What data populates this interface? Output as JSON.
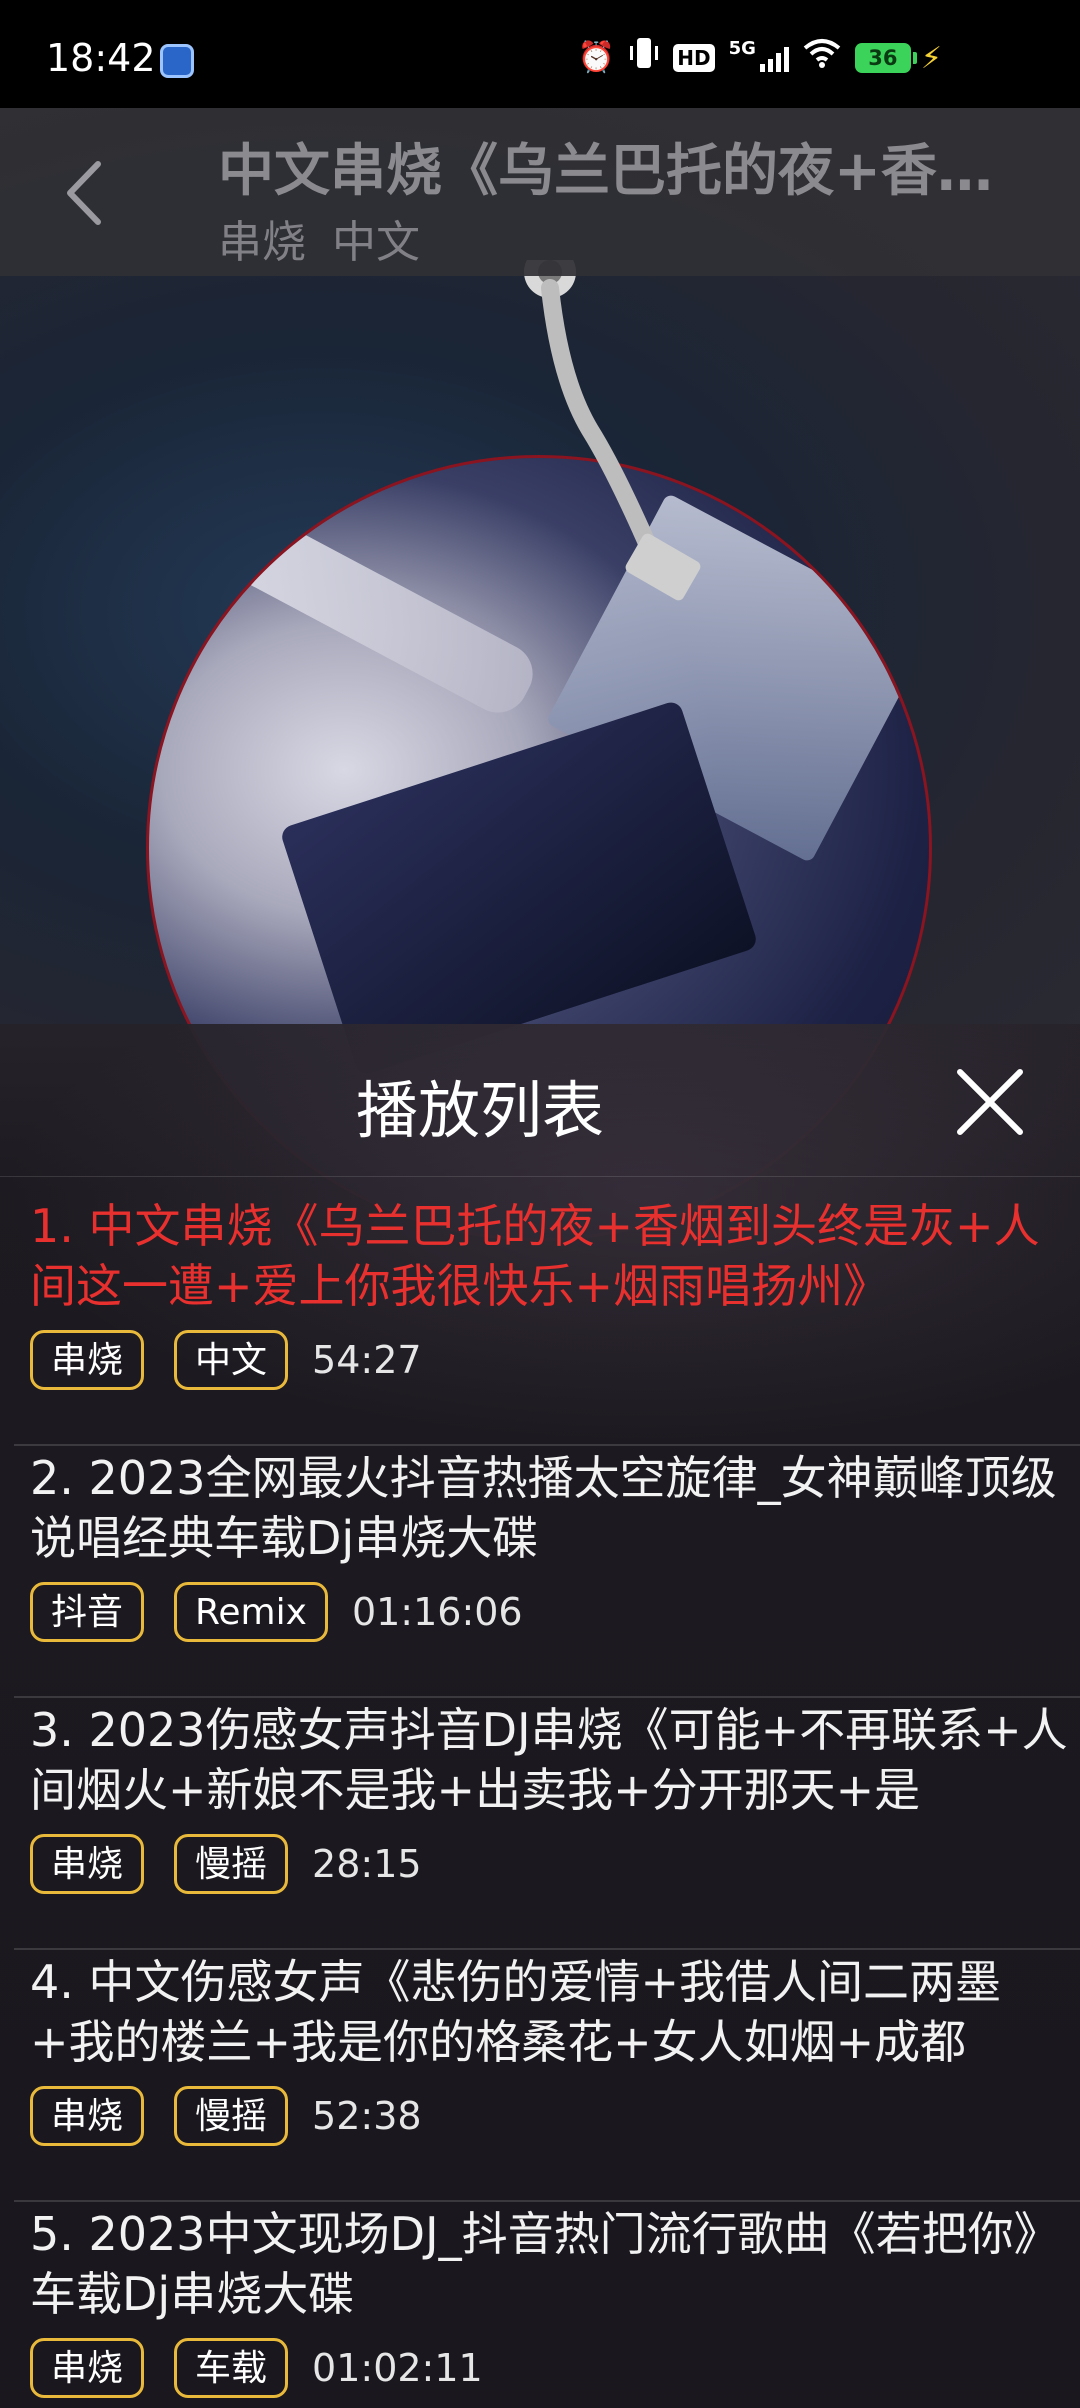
{
  "status_bar": {
    "time": "18:42",
    "battery": "36",
    "network": "5G",
    "hd": "HD"
  },
  "player": {
    "title": "中文串烧《乌兰巴托的夜+香…",
    "tags": [
      "串烧",
      "中文"
    ]
  },
  "playlist": {
    "title": "播放列表",
    "items": [
      {
        "title": "1. 中文串烧《乌兰巴托的夜+香烟到头终是灰+人间这一遭+爱上你我很快乐+烟雨唱扬州》",
        "tags": [
          "串烧",
          "中文"
        ],
        "duration": "54:27",
        "active": true
      },
      {
        "title": "2. 2023全网最火抖音热播太空旋律_女神巅峰顶级说唱经典车载Dj串烧大碟",
        "tags": [
          "抖音",
          "Remix"
        ],
        "duration": "01:16:06",
        "active": false
      },
      {
        "title": "3. 2023伤感女声抖音DJ串烧《可能+不再联系+人间烟火+新娘不是我+出卖我+分开那天+是",
        "tags": [
          "串烧",
          "慢摇"
        ],
        "duration": "28:15",
        "active": false
      },
      {
        "title": "4. 中文伤感女声《悲伤的爱情+我借人间二两墨+我的楼兰+我是你的格桑花+女人如烟+成都",
        "tags": [
          "串烧",
          "慢摇"
        ],
        "duration": "52:38",
        "active": false
      },
      {
        "title": "5. 2023中文现场DJ_抖音热门流行歌曲《若把你》车载Dj串烧大碟",
        "tags": [
          "串烧",
          "车载"
        ],
        "duration": "01:02:11",
        "active": false
      }
    ]
  }
}
